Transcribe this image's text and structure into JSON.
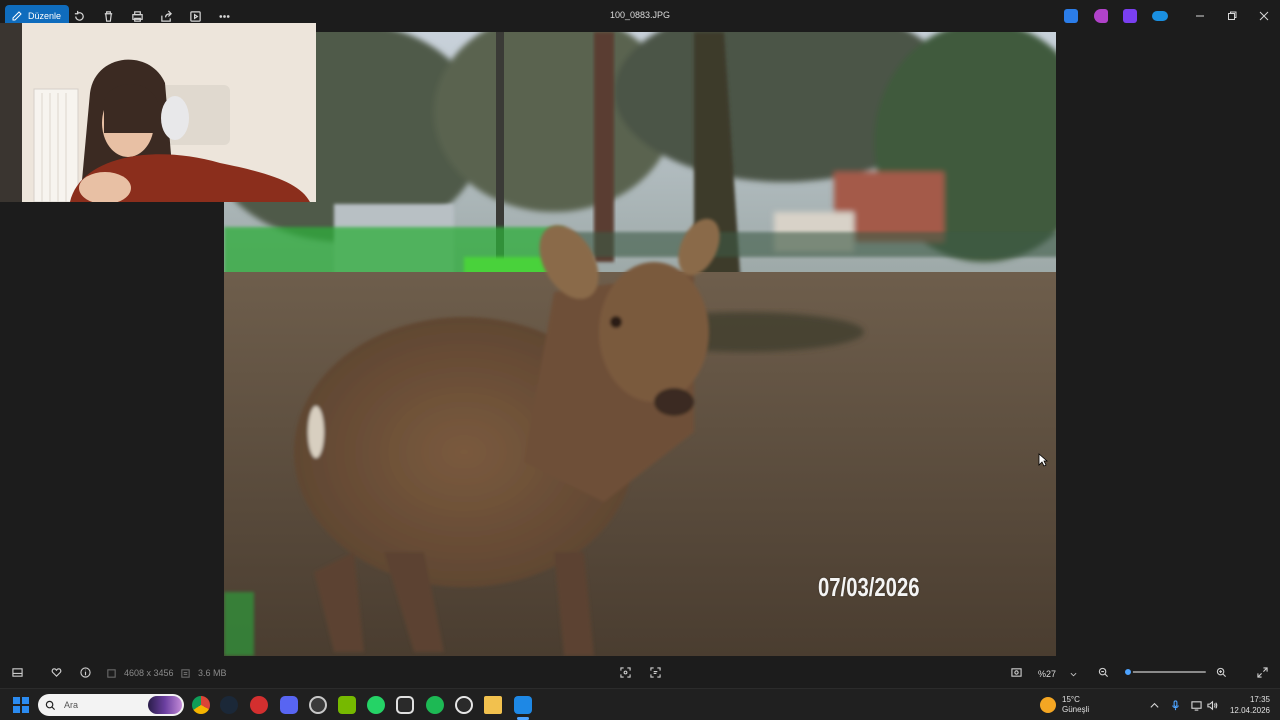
{
  "titlebar": {
    "edit_label": "Düzenle",
    "file_name": "100_0883.JPG",
    "toolbar_icons": [
      "rotate-icon",
      "delete-icon",
      "print-icon",
      "share-icon",
      "slideshow-icon",
      "more-icon"
    ],
    "app_badges": [
      "#2b7de9",
      "#b042c9",
      "#7a3ff0",
      "#1a8fe0"
    ]
  },
  "photo": {
    "date_stamp": "07/03/2026"
  },
  "infobar": {
    "dimensions": "4608 x 3456",
    "file_size": "3.6 MB",
    "zoom_value": "%27",
    "zoom_level": 0.05
  },
  "taskbar": {
    "search_placeholder": "Ara",
    "weather_temp": "15°C",
    "weather_desc": "Güneşli",
    "time": "17:35",
    "date": "12.04.2026",
    "apps": [
      {
        "name": "chrome",
        "color": "#db4437"
      },
      {
        "name": "steam",
        "color": "#1b2838"
      },
      {
        "name": "antivirus",
        "color": "#d32f2f"
      },
      {
        "name": "discord",
        "color": "#5865f2"
      },
      {
        "name": "browser",
        "color": "#3a3a3a"
      },
      {
        "name": "nvidia",
        "color": "#76b900"
      },
      {
        "name": "whatsapp",
        "color": "#25d366"
      },
      {
        "name": "bot",
        "color": "#2a2a2a"
      },
      {
        "name": "spotify",
        "color": "#1db954"
      },
      {
        "name": "chatgpt",
        "color": "#2a2a2a"
      },
      {
        "name": "file-explorer",
        "color": "#f2c14e"
      },
      {
        "name": "photos",
        "color": "#1e88e5"
      }
    ]
  }
}
